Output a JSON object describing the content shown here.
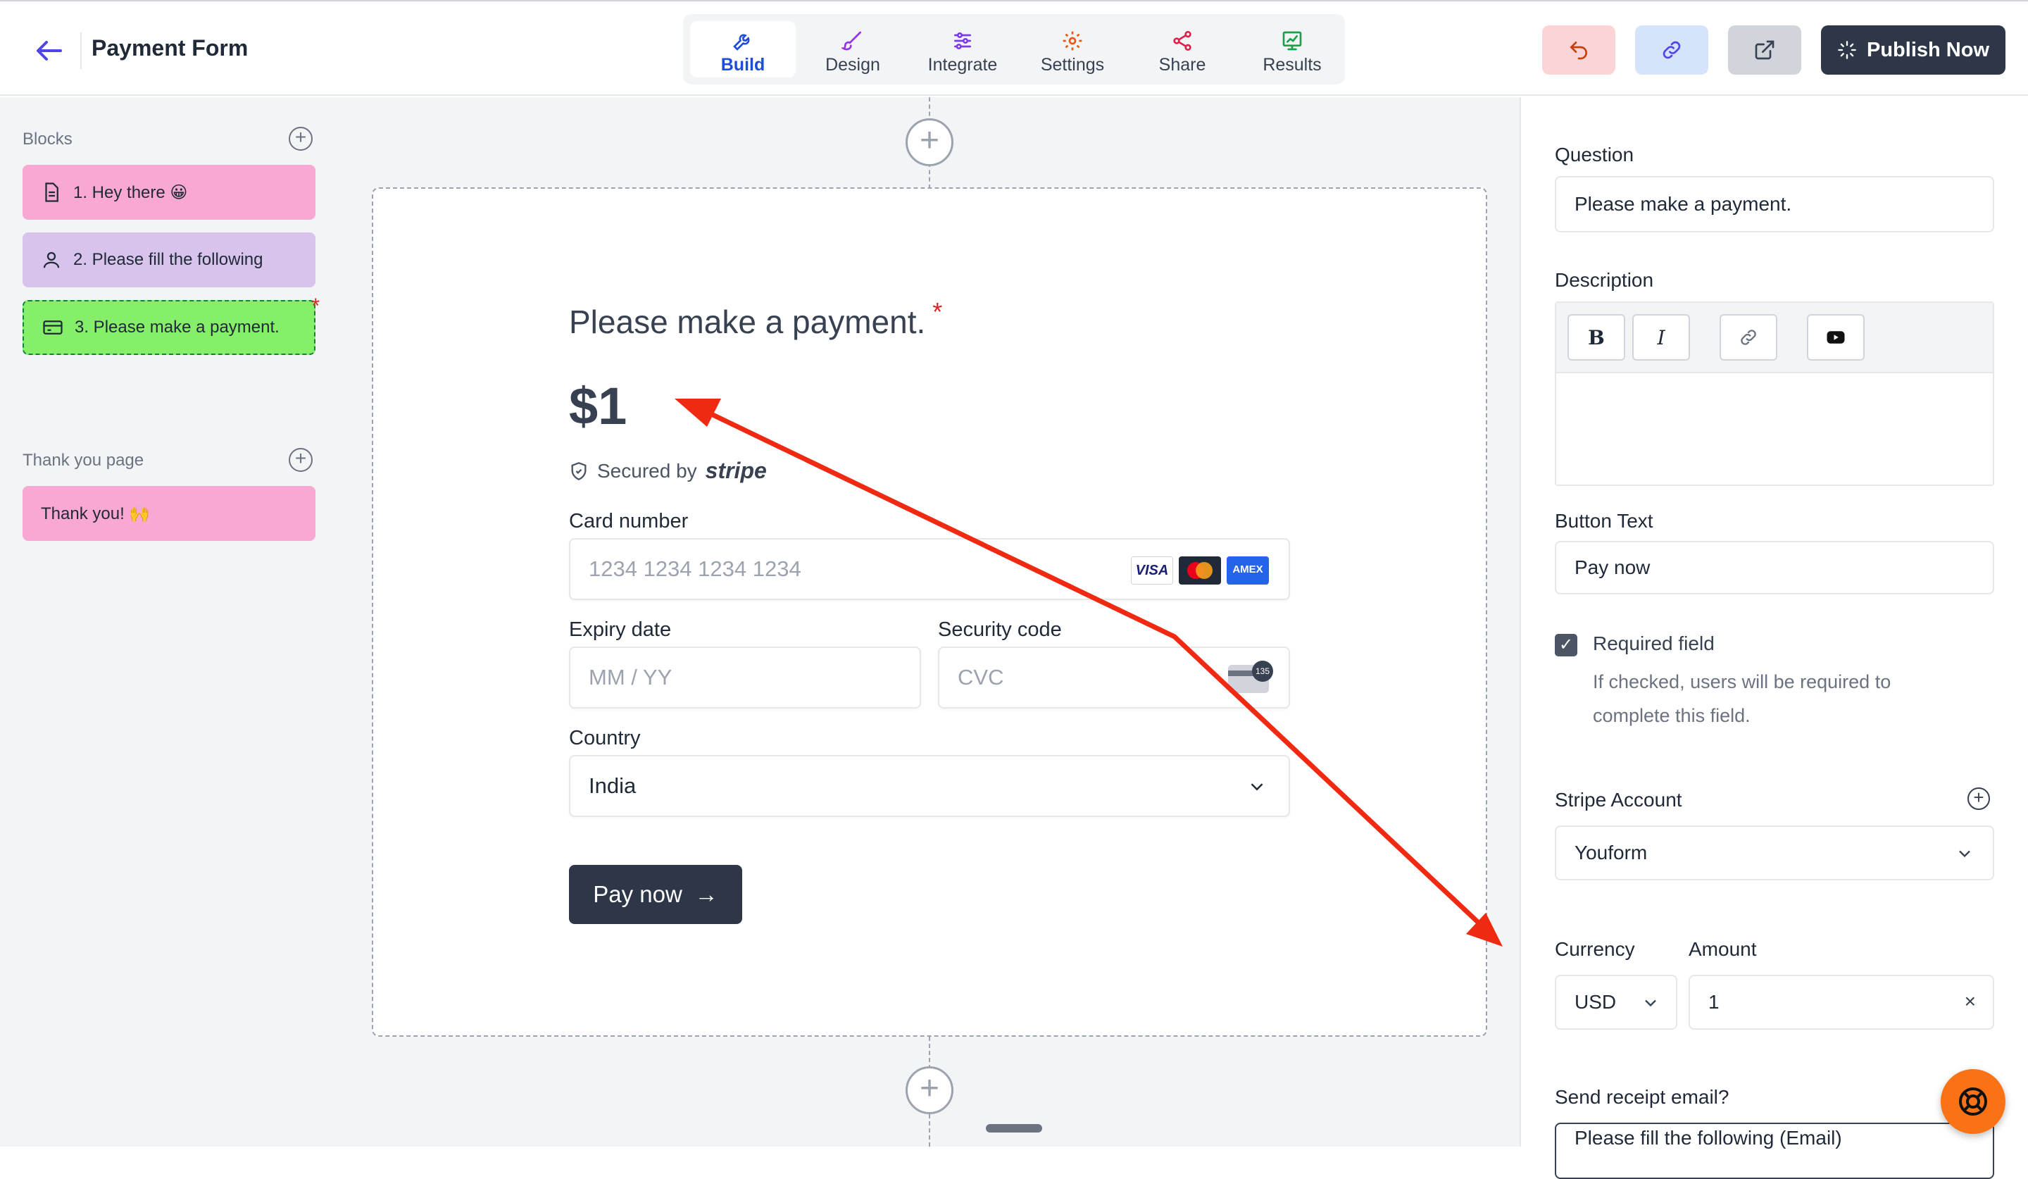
{
  "header": {
    "title": "Payment Form",
    "tabs": [
      {
        "label": "Build",
        "icon": "wrench-icon",
        "active": true,
        "color": "#1d4ed8"
      },
      {
        "label": "Design",
        "icon": "brush-icon",
        "color": "#9333ea"
      },
      {
        "label": "Integrate",
        "icon": "sliders-icon",
        "color": "#7c3aed"
      },
      {
        "label": "Settings",
        "icon": "gear-icon",
        "color": "#ea580c"
      },
      {
        "label": "Share",
        "icon": "share-icon",
        "color": "#e11d48"
      },
      {
        "label": "Results",
        "icon": "chart-icon",
        "color": "#16a34a"
      }
    ],
    "publish_label": "Publish Now"
  },
  "sidebar": {
    "blocks_label": "Blocks",
    "blocks": [
      {
        "label": "1. Hey there 😀",
        "icon": "document-icon",
        "color": "#f9a8d4"
      },
      {
        "label": "2. Please fill the following",
        "icon": "user-icon",
        "color": "#d8c3ec"
      },
      {
        "label": "3. Please make a payment.",
        "icon": "card-icon",
        "color": "#86ef6a",
        "selected": true
      }
    ],
    "thankyou_label": "Thank you page",
    "thankyou_blocks": [
      {
        "label": "Thank you! 🙌",
        "color": "#f9a8d4"
      }
    ]
  },
  "form": {
    "question": "Please make a payment.",
    "required_mark": "*",
    "amount": "$1",
    "secured_by": "Secured by",
    "stripe": "stripe",
    "card_number_label": "Card number",
    "card_number_placeholder": "1234 1234 1234 1234",
    "expiry_label": "Expiry date",
    "expiry_placeholder": "MM / YY",
    "security_label": "Security code",
    "security_placeholder": "CVC",
    "country_label": "Country",
    "country_value": "India",
    "pay_button": "Pay now",
    "card_brands": [
      "VISA",
      "MC",
      "AMEX"
    ],
    "cvc_badge": "135"
  },
  "panel": {
    "question_label": "Question",
    "question_value": "Please make a payment.",
    "description_label": "Description",
    "button_text_label": "Button Text",
    "button_text_value": "Pay now",
    "required_label": "Required field",
    "required_checked": true,
    "required_help": "If checked, users will be required to complete this field.",
    "stripe_account_label": "Stripe Account",
    "stripe_account_value": "Youform",
    "currency_label": "Currency",
    "currency_value": "USD",
    "amount_label": "Amount",
    "amount_value": "1",
    "receipt_label": "Send receipt email?",
    "receipt_partial": "Please fill the following (Email)"
  },
  "colors": {
    "annotation_arrow": "#f02a12",
    "accent": "#4f46e5",
    "dark_button": "#2d3748"
  }
}
